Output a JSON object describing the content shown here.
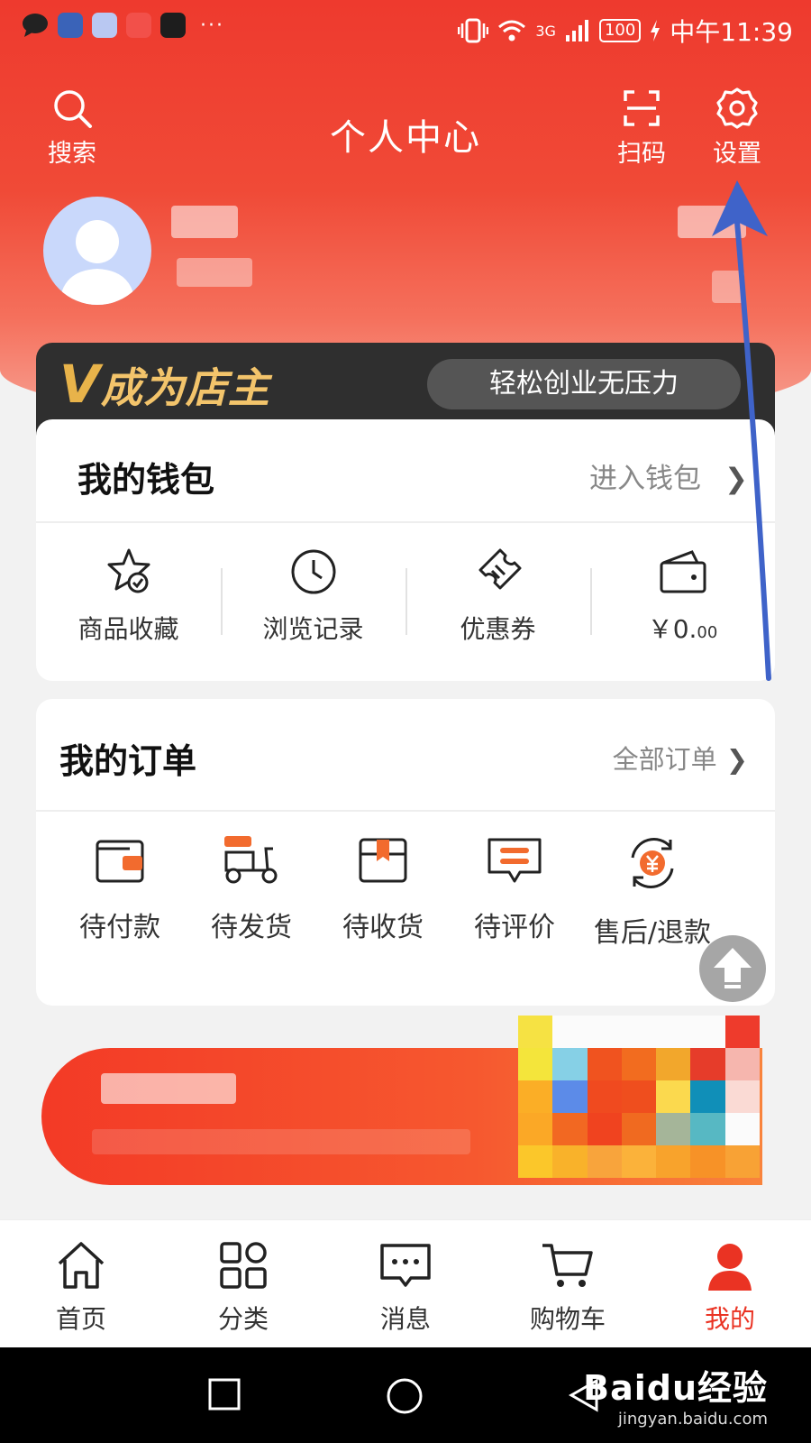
{
  "status_bar": {
    "network": "3G",
    "battery": "100",
    "time": "中午11:39",
    "more": "···"
  },
  "header": {
    "title": "个人中心",
    "search_label": "搜索",
    "scan_label": "扫码",
    "settings_label": "设置"
  },
  "shop_banner": {
    "logo_v": "V",
    "logo_text": "成为店主",
    "slogan": "轻松创业无压力"
  },
  "wallet": {
    "title": "我的钱包",
    "link": "进入钱包",
    "items": [
      {
        "label": "商品收藏",
        "icon": "star-check-icon"
      },
      {
        "label": "浏览记录",
        "icon": "clock-icon"
      },
      {
        "label": "优惠券",
        "icon": "ticket-icon"
      }
    ],
    "balance_main": "￥0.",
    "balance_cents": "00"
  },
  "orders": {
    "title": "我的订单",
    "link": "全部订单",
    "items": [
      {
        "label": "待付款",
        "icon": "wallet-icon"
      },
      {
        "label": "待发货",
        "icon": "delivery-scooter-icon"
      },
      {
        "label": "待收货",
        "icon": "package-icon"
      },
      {
        "label": "待评价",
        "icon": "comment-icon"
      },
      {
        "label": "售后/退款",
        "icon": "refund-yen-icon"
      }
    ]
  },
  "tabbar": {
    "items": [
      {
        "label": "首页",
        "icon": "home-icon"
      },
      {
        "label": "分类",
        "icon": "grid-icon"
      },
      {
        "label": "消息",
        "icon": "message-icon"
      },
      {
        "label": "购物车",
        "icon": "cart-icon"
      },
      {
        "label": "我的",
        "icon": "user-icon",
        "active": true
      }
    ]
  },
  "watermark": {
    "brand": "Baidu经验",
    "url": "jingyan.baidu.com"
  },
  "colors": {
    "primary_red": "#ea3323",
    "accent_orange": "#f26b2e",
    "arrow_blue": "#3f63c9"
  }
}
